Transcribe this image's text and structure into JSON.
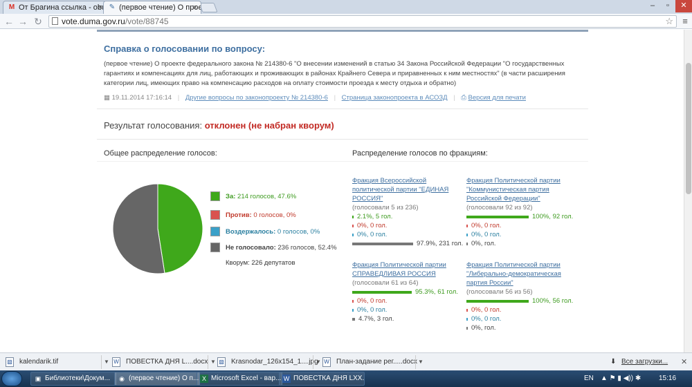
{
  "tabs": [
    {
      "icon": "gmail-icon",
      "title": "От Брагина ссылка - obu"
    },
    {
      "icon": "duma-icon",
      "title": "(первое чтение) О проек"
    }
  ],
  "address": {
    "host": "vote.duma.gov.ru",
    "path": "/vote/88745"
  },
  "page": {
    "title": "Справка о голосовании по вопросу:",
    "description": "(первое чтение) О проекте федерального закона № 214380-6 \"О внесении изменений в статью 34 Закона Российской Федерации \"О государственных гарантиях и компенсациях для лиц, работающих и проживающих в районах Крайнего Севера и приравненных к ним местностях\" (в части расширения категории лиц, имеющих право на компенсацию расходов на оплату стоимости проезда к месту отдыха и обратно)",
    "datetime": "19.11.2014 17:16:14",
    "links": {
      "other": "Другие вопросы по законопроекту № 214380-6",
      "asozd": "Страница законопроекта в АСОЗД",
      "print": "Версия для печати"
    },
    "result_label": "Результат голосования:",
    "result_value": "отклонен (не набран кворум)",
    "overall_title": "Общее распределение голосов:",
    "factions_title": "Распределение голосов по фракциям:",
    "legend": [
      {
        "label": "За:",
        "text": "214 голосов, 47.6%",
        "color": "#3fa81b",
        "cls": "green"
      },
      {
        "label": "Против:",
        "text": "0 голосов, 0%",
        "color": "#d9534f",
        "cls": "red"
      },
      {
        "label": "Воздержалось:",
        "text": "0 голосов, 0%",
        "color": "#3aa0c8",
        "cls": "blue"
      },
      {
        "label": "Не голосовало:",
        "text": "236 голосов, 52.4%",
        "color": "#666666",
        "cls": "gray"
      }
    ],
    "quorum": "Кворум: 226 депутатов",
    "factions": [
      {
        "name": "Фракция Всероссийской политической партии \"ЕДИНАЯ РОССИЯ\"",
        "voted": "(голосовали 5 из 236)",
        "rows": [
          {
            "text": "2.1%, 5 гол.",
            "frac": 0.021,
            "cls": "green",
            "color": "#3fa81b"
          },
          {
            "text": "0%, 0 гол.",
            "frac": 0,
            "cls": "red",
            "color": "#d9534f"
          },
          {
            "text": "0%, 0 гол.",
            "frac": 0,
            "cls": "blue",
            "color": "#3aa0c8"
          },
          {
            "text": "97.9%, 231 гол.",
            "frac": 0.979,
            "cls": "gray",
            "color": "#777777"
          }
        ]
      },
      {
        "name": "Фракция Политической партии \"Коммунистическая партия Российской Федерации\"",
        "voted": "(голосовали 92 из 92)",
        "rows": [
          {
            "text": "100%, 92 гол.",
            "frac": 1,
            "cls": "green",
            "color": "#3fa81b"
          },
          {
            "text": "0%, 0 гол.",
            "frac": 0,
            "cls": "red",
            "color": "#d9534f"
          },
          {
            "text": "0%, 0 гол.",
            "frac": 0,
            "cls": "blue",
            "color": "#3aa0c8"
          },
          {
            "text": "0%, гол.",
            "frac": 0,
            "cls": "gray",
            "color": "#777777"
          }
        ]
      },
      {
        "name": "Фракция Политической партии СПРАВЕДЛИВАЯ РОССИЯ",
        "voted": "(голосовали 61 из 64)",
        "rows": [
          {
            "text": "95.3%, 61 гол.",
            "frac": 0.953,
            "cls": "green",
            "color": "#3fa81b"
          },
          {
            "text": "0%, 0 гол.",
            "frac": 0,
            "cls": "red",
            "color": "#d9534f"
          },
          {
            "text": "0%, 0 гол.",
            "frac": 0,
            "cls": "blue",
            "color": "#3aa0c8"
          },
          {
            "text": "4.7%, 3 гол.",
            "frac": 0.047,
            "cls": "gray",
            "color": "#777777"
          }
        ]
      },
      {
        "name": "Фракция Политической партии \"Либерально-демократическая партия России\"",
        "voted": "(голосовали 56 из 56)",
        "rows": [
          {
            "text": "100%, 56 гол.",
            "frac": 1,
            "cls": "green",
            "color": "#3fa81b"
          },
          {
            "text": "0%, 0 гол.",
            "frac": 0,
            "cls": "red",
            "color": "#d9534f"
          },
          {
            "text": "0%, 0 гол.",
            "frac": 0,
            "cls": "blue",
            "color": "#3aa0c8"
          },
          {
            "text": "0%, гол.",
            "frac": 0,
            "cls": "gray",
            "color": "#777777"
          }
        ]
      }
    ]
  },
  "chart_data": {
    "type": "pie",
    "labels": [
      "За",
      "Против",
      "Воздержалось",
      "Не голосовало"
    ],
    "values": [
      214,
      0,
      0,
      236
    ],
    "percent": [
      47.6,
      0,
      0,
      52.4
    ],
    "colors": [
      "#3fa81b",
      "#d9534f",
      "#3aa0c8",
      "#666666"
    ]
  },
  "downloads": [
    {
      "icon": "image-file-icon",
      "name": "kalendarik.tif"
    },
    {
      "icon": "word-file-icon",
      "name": "ПОВЕСТКА ДНЯ L....docx"
    },
    {
      "icon": "image-file-icon",
      "name": "Krasnodar_126x154_1....jpg"
    },
    {
      "icon": "word-file-icon",
      "name": "План-задание рег.....docx"
    }
  ],
  "all_downloads": "Все загрузки...",
  "taskbar": [
    {
      "icon": "folder-icon",
      "title": "Библиотеки\\Докум..."
    },
    {
      "icon": "chrome-icon",
      "title": "(первое чтение) О п..."
    },
    {
      "icon": "excel-icon",
      "title": "Microsoft Excel - вар..."
    },
    {
      "icon": "word-icon",
      "title": "ПОВЕСТКА ДНЯ LXX..."
    }
  ],
  "tray": {
    "lang": "EN",
    "time": "15:16"
  }
}
